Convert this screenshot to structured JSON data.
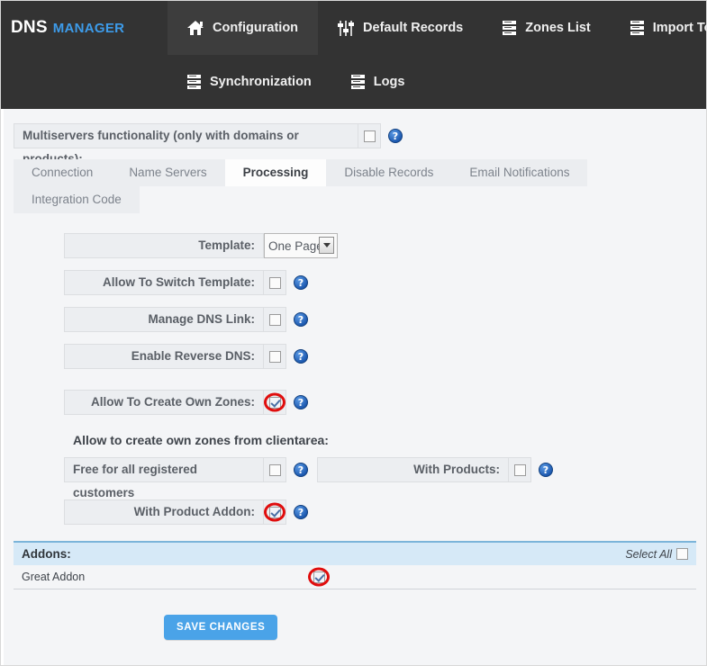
{
  "brand": {
    "primary": "DNS",
    "secondary": "MANAGER"
  },
  "nav": {
    "row1": [
      {
        "label": "Configuration",
        "icon": "home-icon",
        "active": true
      },
      {
        "label": "Default Records",
        "icon": "sliders-icon",
        "active": false
      },
      {
        "label": "Zones List",
        "icon": "server-icon",
        "active": false
      },
      {
        "label": "Import Tool",
        "icon": "server-icon",
        "active": false
      }
    ],
    "row2": [
      {
        "label": "Synchronization",
        "icon": "server-icon",
        "active": false
      },
      {
        "label": "Logs",
        "icon": "server-icon",
        "active": false
      }
    ]
  },
  "multiservers": {
    "label": "Multiservers functionality (only with domains or products):",
    "checked": false,
    "help": "?"
  },
  "tabs": [
    {
      "label": "Connection",
      "active": false
    },
    {
      "label": "Name Servers",
      "active": false
    },
    {
      "label": "Processing",
      "active": true
    },
    {
      "label": "Disable Records",
      "active": false
    },
    {
      "label": "Email Notifications",
      "active": false
    },
    {
      "label": "Integration Code",
      "active": false
    }
  ],
  "form": {
    "template": {
      "label": "Template:",
      "value": "One Page",
      "options": [
        "One Page"
      ]
    },
    "rows": [
      {
        "label": "Allow To Switch Template:",
        "checked": false,
        "highlighted": false,
        "help": "?"
      },
      {
        "label": "Manage DNS Link:",
        "checked": false,
        "highlighted": false,
        "help": "?"
      },
      {
        "label": "Enable Reverse DNS:",
        "checked": false,
        "highlighted": false,
        "help": "?"
      },
      {
        "label": "Allow To Create Own Zones:",
        "checked": true,
        "highlighted": true,
        "help": "?"
      }
    ],
    "clientarea_title": "Allow to create own zones from clientarea:",
    "free_for_all": {
      "label": "Free for all registered customers",
      "checked": false,
      "help": "?"
    },
    "with_products": {
      "label": "With Products:",
      "checked": false,
      "help": "?"
    },
    "with_product_addon": {
      "label": "With Product Addon:",
      "checked": true,
      "highlighted": true,
      "help": "?"
    }
  },
  "addons": {
    "title": "Addons:",
    "select_all_label": "Select All",
    "select_all_checked": false,
    "rows": [
      {
        "name": "Great Addon",
        "checked": true,
        "highlighted": true
      }
    ]
  },
  "actions": {
    "save_label": "SAVE CHANGES"
  },
  "colors": {
    "navbar": "#333333",
    "nav_active": "#3d3d3d",
    "brand_accent": "#3d9be9",
    "content_bg": "#f4f5f7",
    "field_bg": "#eceef1",
    "addons_head_bg": "#d6e9f7",
    "addons_head_border": "#7bb4d9",
    "save_btn": "#4aa3e8",
    "annotation_ring": "#e00d0d",
    "help_icon": "#1a56ad"
  }
}
